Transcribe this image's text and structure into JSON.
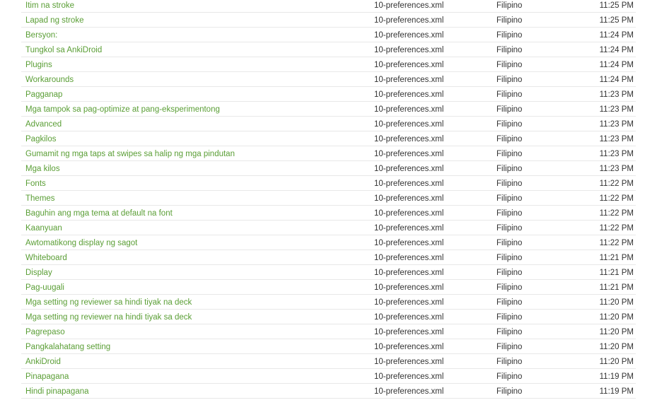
{
  "rows": [
    {
      "title": "Itim na stroke",
      "file": "10-preferences.xml",
      "language": "Filipino",
      "time": "11:25 PM"
    },
    {
      "title": "Lapad ng stroke",
      "file": "10-preferences.xml",
      "language": "Filipino",
      "time": "11:25 PM"
    },
    {
      "title": "Bersyon:",
      "file": "10-preferences.xml",
      "language": "Filipino",
      "time": "11:24 PM"
    },
    {
      "title": "Tungkol sa AnkiDroid",
      "file": "10-preferences.xml",
      "language": "Filipino",
      "time": "11:24 PM"
    },
    {
      "title": "Plugins",
      "file": "10-preferences.xml",
      "language": "Filipino",
      "time": "11:24 PM"
    },
    {
      "title": "Workarounds",
      "file": "10-preferences.xml",
      "language": "Filipino",
      "time": "11:24 PM"
    },
    {
      "title": "Pagganap",
      "file": "10-preferences.xml",
      "language": "Filipino",
      "time": "11:23 PM"
    },
    {
      "title": "Mga tampok sa pag-optimize at pang-eksperimentong",
      "file": "10-preferences.xml",
      "language": "Filipino",
      "time": "11:23 PM"
    },
    {
      "title": "Advanced",
      "file": "10-preferences.xml",
      "language": "Filipino",
      "time": "11:23 PM"
    },
    {
      "title": "Pagkilos",
      "file": "10-preferences.xml",
      "language": "Filipino",
      "time": "11:23 PM"
    },
    {
      "title": "Gumamit ng mga taps at swipes sa halip ng mga pindutan",
      "file": "10-preferences.xml",
      "language": "Filipino",
      "time": "11:23 PM"
    },
    {
      "title": "Mga kilos",
      "file": "10-preferences.xml",
      "language": "Filipino",
      "time": "11:23 PM"
    },
    {
      "title": "Fonts",
      "file": "10-preferences.xml",
      "language": "Filipino",
      "time": "11:22 PM"
    },
    {
      "title": "Themes",
      "file": "10-preferences.xml",
      "language": "Filipino",
      "time": "11:22 PM"
    },
    {
      "title": "Baguhin ang mga tema at default na font",
      "file": "10-preferences.xml",
      "language": "Filipino",
      "time": "11:22 PM"
    },
    {
      "title": "Kaanyuan",
      "file": "10-preferences.xml",
      "language": "Filipino",
      "time": "11:22 PM"
    },
    {
      "title": "Awtomatikong display ng sagot",
      "file": "10-preferences.xml",
      "language": "Filipino",
      "time": "11:22 PM"
    },
    {
      "title": "Whiteboard",
      "file": "10-preferences.xml",
      "language": "Filipino",
      "time": "11:21 PM"
    },
    {
      "title": "Display",
      "file": "10-preferences.xml",
      "language": "Filipino",
      "time": "11:21 PM"
    },
    {
      "title": "Pag-uugali",
      "file": "10-preferences.xml",
      "language": "Filipino",
      "time": "11:21 PM"
    },
    {
      "title": "Mga setting ng reviewer sa hindi tiyak na deck",
      "file": "10-preferences.xml",
      "language": "Filipino",
      "time": "11:20 PM"
    },
    {
      "title": "Mga setting ng reviewer na hindi tiyak sa deck",
      "file": "10-preferences.xml",
      "language": "Filipino",
      "time": "11:20 PM"
    },
    {
      "title": "Pagrepaso",
      "file": "10-preferences.xml",
      "language": "Filipino",
      "time": "11:20 PM"
    },
    {
      "title": "Pangkalahatang setting",
      "file": "10-preferences.xml",
      "language": "Filipino",
      "time": "11:20 PM"
    },
    {
      "title": "AnkiDroid",
      "file": "10-preferences.xml",
      "language": "Filipino",
      "time": "11:20 PM"
    },
    {
      "title": "Pinapagana",
      "file": "10-preferences.xml",
      "language": "Filipino",
      "time": "11:19 PM"
    },
    {
      "title": "Hindi pinapagana",
      "file": "10-preferences.xml",
      "language": "Filipino",
      "time": "11:19 PM"
    }
  ],
  "colors": {
    "link": "#5a9e35",
    "text": "#333333",
    "divider": "#e8e8e8"
  }
}
